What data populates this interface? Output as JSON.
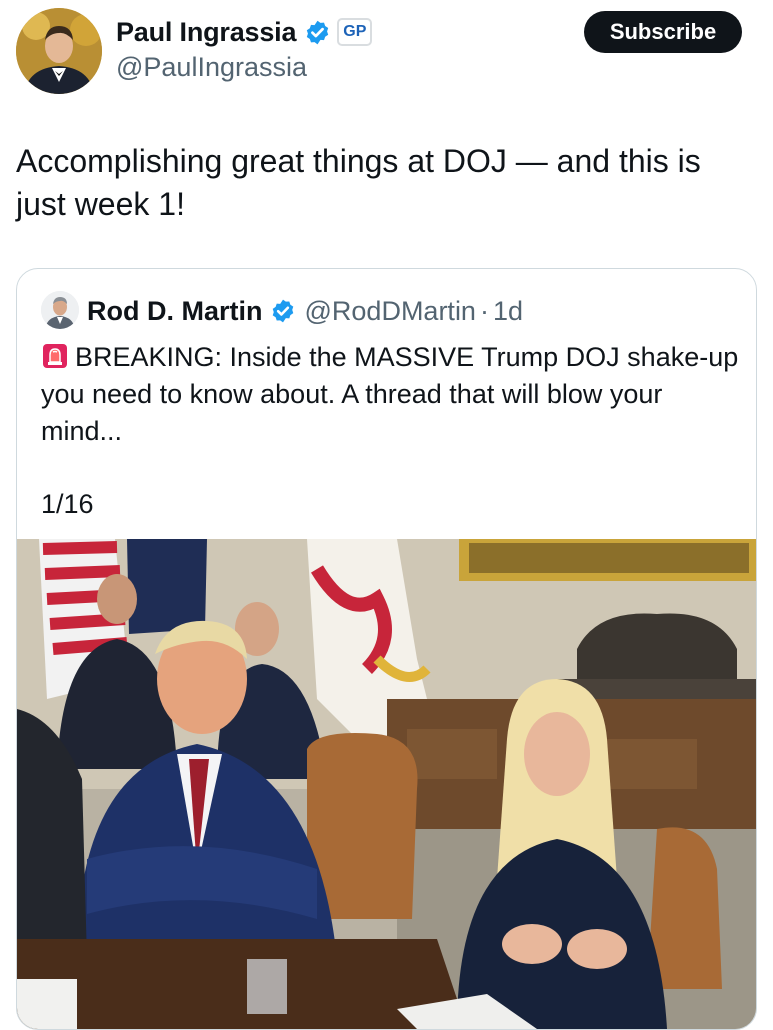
{
  "author": {
    "name": "Paul Ingrassia",
    "handle": "@PaulIngrassia",
    "badge": "GP",
    "avatar_icon": "profile-photo-avatar",
    "verified_icon": "verified-badge-icon"
  },
  "subscribe_label": "Subscribe",
  "tweet": {
    "text": "Accomplishing great things at DOJ — and this is just week 1!"
  },
  "quote": {
    "name": "Rod D. Martin",
    "handle": "@RodDMartin",
    "separator": "·",
    "time": "1d",
    "siren_icon": "police-light-emoji",
    "text": "BREAKING: Inside the MASSIVE Trump DOJ shake-up you need to know about. A thread that will blow your mind...",
    "counter": "1/16",
    "media": "photo"
  },
  "colors": {
    "verified_blue": "#1d9bf0",
    "text": "#0f1419",
    "muted": "#536471",
    "border": "#cfd9de",
    "subscribe_bg": "#0f1419"
  }
}
